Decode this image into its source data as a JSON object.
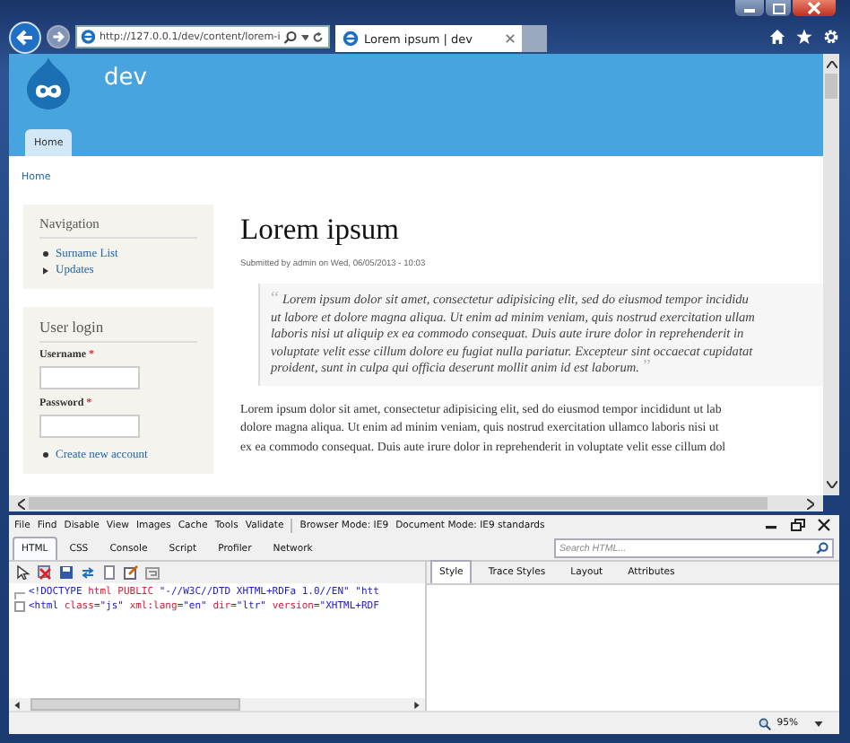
{
  "browser": {
    "address": "http://127.0.0.1/dev/content/lorem-i",
    "tab_title": "Lorem ipsum | dev"
  },
  "site": {
    "name": "dev",
    "tabs": [
      {
        "label": "Home",
        "selected": true
      }
    ],
    "breadcrumb": "Home"
  },
  "sidebar": {
    "navigation": {
      "title": "Navigation",
      "links": [
        "Surname List",
        "Updates"
      ]
    },
    "user_login": {
      "title": "User login",
      "fields": [
        {
          "label": "Username",
          "required_mark": "*"
        },
        {
          "label": "Password",
          "required_mark": "*"
        }
      ],
      "links": [
        "Create new account"
      ]
    }
  },
  "article": {
    "title": "Lorem ipsum",
    "submitted": "Submitted by admin on Wed, 06/05/2013 - 10:03",
    "quote_open": "“",
    "quote_close": "”",
    "quote_lines": [
      "Lorem ipsum dolor sit amet, consectetur adipisicing elit, sed do eiusmod tempor incididu",
      "ut labore et dolore magna aliqua. Ut enim ad minim veniam, quis nostrud exercitation ullam",
      "laboris nisi ut aliquip ex ea commodo consequat. Duis aute irure dolor in reprehenderit in",
      "voluptate velit esse cillum dolore eu fugiat nulla pariatur. Excepteur sint occaecat cupidatat",
      "proident, sunt in culpa qui officia deserunt mollit anim id est laborum."
    ],
    "paragraph_lines": [
      "Lorem ipsum dolor sit amet, consectetur adipisicing elit, sed do eiusmod tempor incididunt ut lab",
      "dolore magna aliqua. Ut enim ad minim veniam, quis nostrud exercitation ullamco laboris nisi ut",
      "ex ea commodo consequat. Duis aute irure dolor in reprehenderit in voluptate velit esse cillum dol"
    ]
  },
  "devtools": {
    "menu": [
      "File",
      "Find",
      "Disable",
      "View",
      "Images",
      "Cache",
      "Tools",
      "Validate"
    ],
    "modes": [
      "Browser Mode: IE9",
      "Document Mode: IE9 standards"
    ],
    "tabs": [
      {
        "label": "HTML",
        "selected": true
      },
      {
        "label": "CSS",
        "selected": false
      },
      {
        "label": "Console",
        "selected": false
      },
      {
        "label": "Script",
        "selected": false
      },
      {
        "label": "Profiler",
        "selected": false
      },
      {
        "label": "Network",
        "selected": false
      }
    ],
    "search": {
      "placeholder": "Search HTML..."
    },
    "panel_tabs": [
      {
        "label": "Style",
        "selected": true
      },
      {
        "label": "Trace Styles",
        "selected": false
      },
      {
        "label": "Layout",
        "selected": false
      },
      {
        "label": "Attributes",
        "selected": false
      }
    ],
    "code_lines": [
      {
        "expandable": false,
        "tokens": [
          {
            "text": "<!DOCTYPE ",
            "kind": "markup"
          },
          {
            "text": "html PUBLIC ",
            "kind": "attr"
          },
          {
            "text": "\"-//W3C//DTD XHTML+RDFa 1.0//EN\" \"htt",
            "kind": "markup"
          }
        ]
      },
      {
        "expandable": true,
        "tokens": [
          {
            "text": "<html ",
            "kind": "markup"
          },
          {
            "text": "class",
            "kind": "attr"
          },
          {
            "text": "=\"js\" ",
            "kind": "markup"
          },
          {
            "text": "xml:lang",
            "kind": "attr"
          },
          {
            "text": "=\"en\" ",
            "kind": "markup"
          },
          {
            "text": "dir",
            "kind": "attr"
          },
          {
            "text": "=\"ltr\" ",
            "kind": "markup"
          },
          {
            "text": "version",
            "kind": "attr"
          },
          {
            "text": "=\"XHTML+RDF",
            "kind": "markup"
          }
        ]
      }
    ],
    "zoom": "95%"
  }
}
